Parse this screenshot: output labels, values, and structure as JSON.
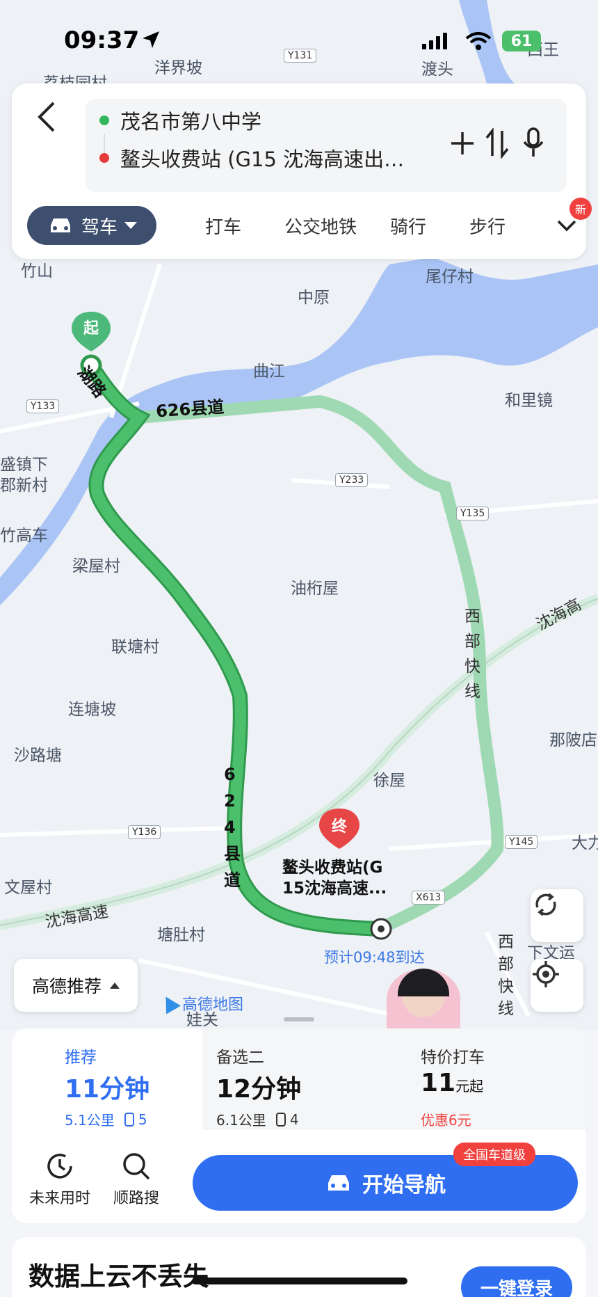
{
  "status_bar": {
    "time": "09:37",
    "battery": "61"
  },
  "search": {
    "origin": "茂名市第八中学",
    "destination": "鳌头收费站 (G15 沈海高速出…",
    "origin_color": "#34b65a",
    "destination_color": "#e63b3b"
  },
  "modes": {
    "active": "驾车",
    "items": [
      "打车",
      "公交地铁",
      "骑行",
      "步行"
    ],
    "new_badge": "新"
  },
  "map": {
    "places": [
      "洋界坡",
      "荔枝园村",
      "渡头",
      "西王",
      "竹山",
      "中原",
      "尾仔村",
      "曲江",
      "和里镜",
      "盛镇下",
      "郡新村",
      "竹高车",
      "梁屋村",
      "油桁屋",
      "联塘村",
      "连塘坡",
      "沙路塘",
      "徐屋",
      "那陂店",
      "文屋村",
      "塘肚村",
      "大力",
      "下文运",
      "娃关"
    ],
    "road_tags": [
      "Y131",
      "Y133",
      "Y233",
      "Y135",
      "Y136",
      "Y145",
      "X613"
    ],
    "road_names": [
      "626县道",
      "624县道",
      "西部快线",
      "沈海高速",
      "湖路",
      "西部快线",
      "沈海高"
    ],
    "start_marker": "起",
    "end_marker": "终",
    "end_label_line1": "鳌头收费站(G",
    "end_label_line2": "15沈海高速...",
    "eta": "预计09:48到达",
    "brand": "高德地图",
    "route_pref": "高德推荐",
    "route_color": "#4cbf6c",
    "alt_route_color": "#9fd9b4"
  },
  "routes": [
    {
      "tab": "推荐",
      "time": "11分钟",
      "distance": "5.1公里",
      "lights": "5"
    },
    {
      "tab": "备选二",
      "time": "12分钟",
      "distance": "6.1公里",
      "lights": "4"
    },
    {
      "tab": "特价打车",
      "price": "11",
      "price_unit": "元起",
      "discount": "优惠6元"
    }
  ],
  "actions": {
    "future": "未来用时",
    "along": "顺路搜",
    "start_nav": "开始导航",
    "badge": "全国车道级"
  },
  "cloud": {
    "title": "数据上云不丢失",
    "login": "一键登录"
  }
}
